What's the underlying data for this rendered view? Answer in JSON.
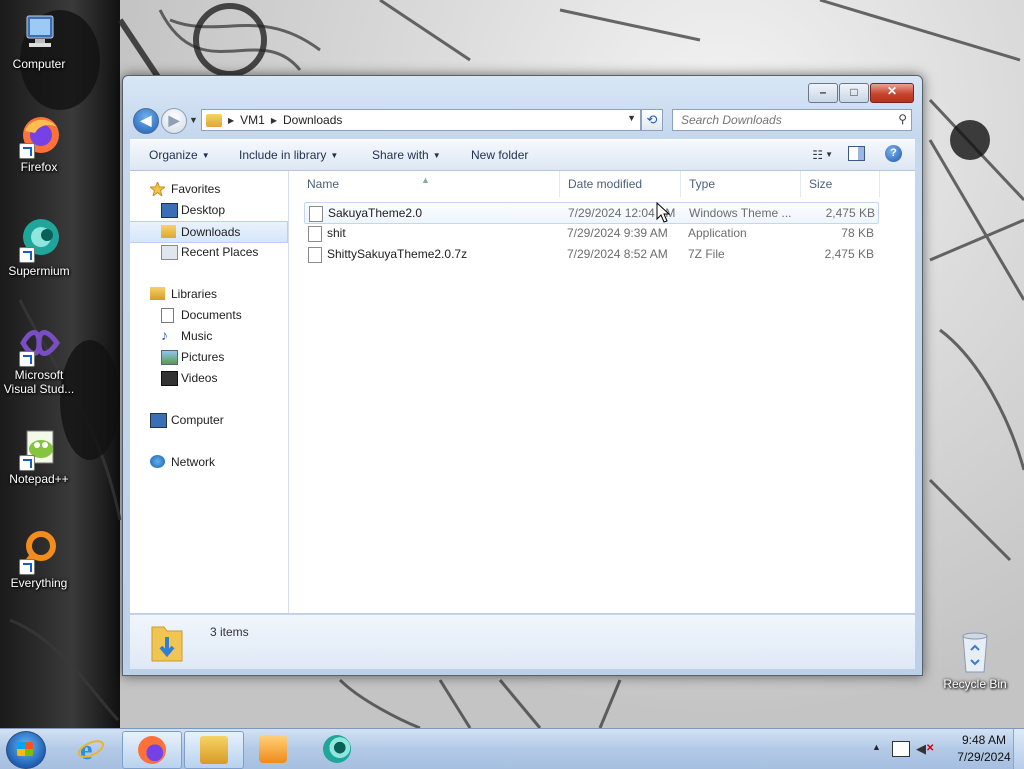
{
  "desktop": {
    "icons": [
      {
        "label": "Computer",
        "icon": "computer-icon"
      },
      {
        "label": "Firefox",
        "icon": "firefox-icon"
      },
      {
        "label": "Supermium",
        "icon": "supermium-icon"
      },
      {
        "label": "Microsoft Visual Stud...",
        "icon": "visual-studio-icon"
      },
      {
        "label": "Notepad++",
        "icon": "notepad-plus-plus-icon"
      },
      {
        "label": "Everything",
        "icon": "everything-search-icon"
      },
      {
        "label": "Recycle Bin",
        "icon": "recycle-bin-icon"
      }
    ]
  },
  "window": {
    "breadcrumb": [
      "VM1",
      "Downloads"
    ],
    "search_placeholder": "Search Downloads",
    "toolbar": {
      "organize": "Organize",
      "include_in_library": "Include in library",
      "share_with": "Share with",
      "new_folder": "New folder"
    },
    "nav": {
      "favorites": "Favorites",
      "desktop": "Desktop",
      "downloads": "Downloads",
      "recent_places": "Recent Places",
      "libraries": "Libraries",
      "documents": "Documents",
      "music": "Music",
      "pictures": "Pictures",
      "videos": "Videos",
      "computer": "Computer",
      "network": "Network"
    },
    "columns": {
      "name": "Name",
      "date_modified": "Date modified",
      "type": "Type",
      "size": "Size"
    },
    "files": [
      {
        "name": "SakuyaTheme2.0",
        "date": "7/29/2024 12:04 AM",
        "type": "Windows Theme ...",
        "size": "2,475 KB",
        "icon": "theme-file-icon"
      },
      {
        "name": "shit",
        "date": "7/29/2024 9:39 AM",
        "type": "Application",
        "size": "78 KB",
        "icon": "application-file-icon"
      },
      {
        "name": "ShittySakuyaTheme2.0.7z",
        "date": "7/29/2024 8:52 AM",
        "type": "7Z File",
        "size": "2,475 KB",
        "icon": "archive-file-icon"
      }
    ],
    "status": {
      "item_count": "3 items"
    }
  },
  "taskbar": {
    "pinned": [
      "internet-explorer-icon",
      "firefox-icon",
      "file-explorer-icon",
      "media-player-icon",
      "supermium-icon"
    ],
    "clock": {
      "time": "9:48 AM",
      "date": "7/29/2024"
    }
  },
  "colors": {
    "window_chrome": "#c6d8ee",
    "selection": "#d6e6fb",
    "close_button": "#c7442e",
    "taskbar": "#b2c9e6"
  }
}
